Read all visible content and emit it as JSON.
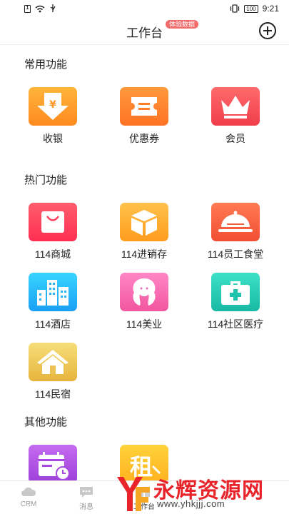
{
  "status_bar": {
    "time": "9:21",
    "battery": "100",
    "sim": "1"
  },
  "header": {
    "title": "工作台",
    "badge": "体验数据"
  },
  "sections": {
    "common": {
      "title": "常用功能",
      "items": [
        {
          "label": "收银",
          "icon": "cashier-icon"
        },
        {
          "label": "优惠券",
          "icon": "coupon-icon"
        },
        {
          "label": "会员",
          "icon": "crown-icon"
        }
      ]
    },
    "hot": {
      "title": "热门功能",
      "items": [
        {
          "label": "114商城",
          "icon": "shopping-bag-icon"
        },
        {
          "label": "114进销存",
          "icon": "box-icon"
        },
        {
          "label": "114员工食堂",
          "icon": "food-cloche-icon"
        },
        {
          "label": "114酒店",
          "icon": "buildings-icon"
        },
        {
          "label": "114美业",
          "icon": "beauty-face-icon"
        },
        {
          "label": "114社区医疗",
          "icon": "medical-kit-icon"
        },
        {
          "label": "114民宿",
          "icon": "house-icon"
        }
      ]
    },
    "other": {
      "title": "其他功能",
      "items": [
        {
          "icon": "calendar-clock-icon"
        },
        {
          "glyph": "租",
          "icon": "rent-icon"
        }
      ]
    }
  },
  "tab_bar": {
    "tabs": [
      {
        "label": "CRM",
        "icon": "cloud-icon"
      },
      {
        "label": "消息",
        "icon": "chat-icon"
      },
      {
        "label": "工作台",
        "icon": "workbench-icon",
        "active": true
      }
    ]
  },
  "watermark": {
    "text": "永辉资源网",
    "url": "www.yhkjjj.com"
  },
  "colors": {
    "badge": "#f26b6b",
    "watermark": "#e8232a"
  }
}
